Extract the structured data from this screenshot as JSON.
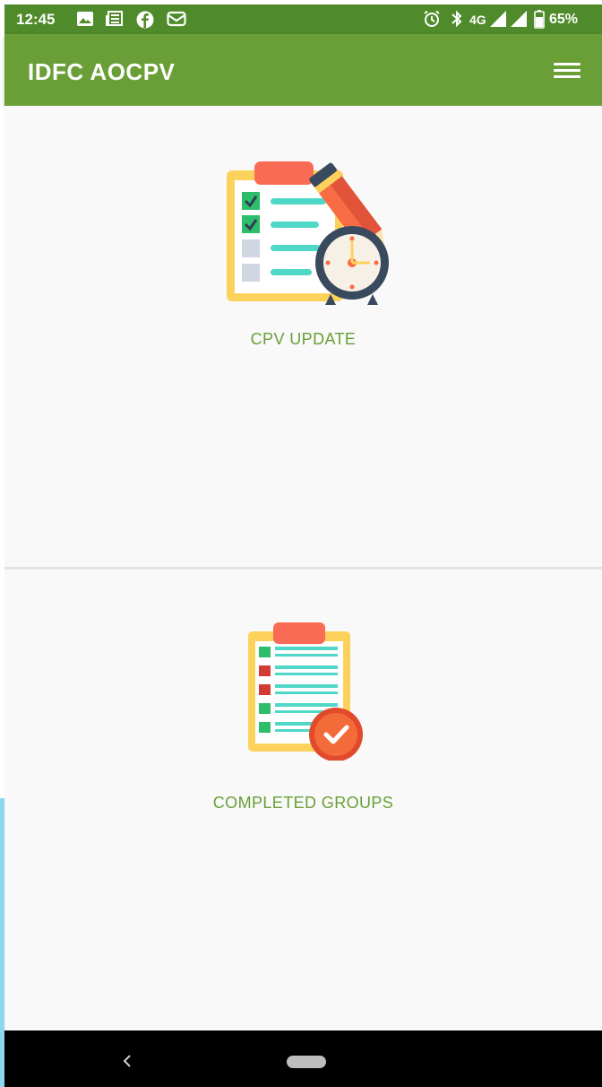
{
  "status_bar": {
    "time": "12:45",
    "left_icons": [
      "image-icon",
      "news-icon",
      "facebook-icon",
      "mail-icon"
    ],
    "right_icons": [
      "alarm-icon",
      "bluetooth-icon",
      "signal-icon",
      "signal-icon",
      "battery-icon"
    ],
    "network": "4G",
    "battery": "65%"
  },
  "app_bar": {
    "title": "IDFC AOCPV",
    "menu_icon": "hamburger-menu-icon"
  },
  "cards": [
    {
      "label": "CPV UPDATE",
      "icon": "checklist-clock-icon"
    },
    {
      "label": "COMPLETED GROUPS",
      "icon": "clipboard-check-icon"
    }
  ],
  "nav_bar": {
    "back_icon": "back-chevron-icon",
    "home_icon": "home-pill-icon"
  },
  "colors": {
    "status_bar": "#4f8b2a",
    "app_bar": "#6a9f37",
    "accent_text": "#6a9f37",
    "background": "#f9f9f9"
  }
}
